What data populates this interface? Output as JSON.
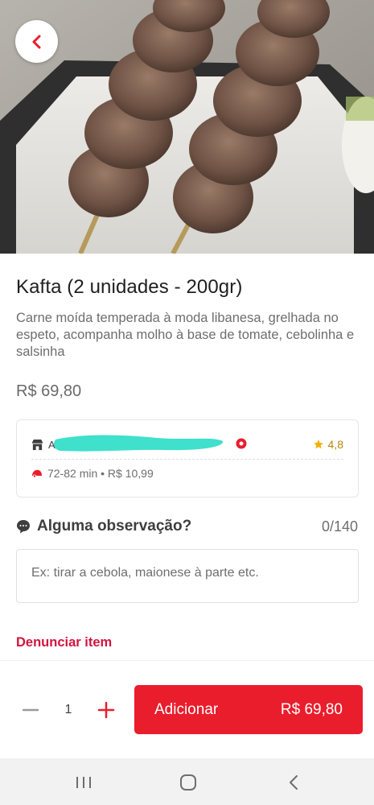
{
  "product": {
    "title": "Kafta (2 unidades - 200gr)",
    "description": "Carne moída temperada à moda libanesa, grelhada no espeto, acompanha molho à base de tomate, cebolinha e salsinha",
    "price": "R$ 69,80"
  },
  "store": {
    "name": "A",
    "rating": "4,8",
    "delivery_info": "72-82 min • R$ 10,99"
  },
  "observation": {
    "label": "Alguma observação?",
    "counter": "0/140",
    "placeholder": "Ex: tirar a cebola, maionese à parte etc."
  },
  "report_label": "Denunciar item",
  "cart": {
    "quantity": "1",
    "add_label": "Adicionar",
    "add_price": "R$ 69,80"
  },
  "colors": {
    "accent": "#ea1d2c",
    "rating": "#f2b000"
  },
  "icons": {
    "back": "chevron-left-icon",
    "store": "store-icon",
    "record": "record-icon",
    "star": "star-icon",
    "delivery": "motorcycle-icon",
    "comment": "chat-bubble-icon",
    "minus": "minus-icon",
    "plus": "plus-icon",
    "nav_recents": "recents-icon",
    "nav_home": "home-icon",
    "nav_back": "back-icon"
  }
}
